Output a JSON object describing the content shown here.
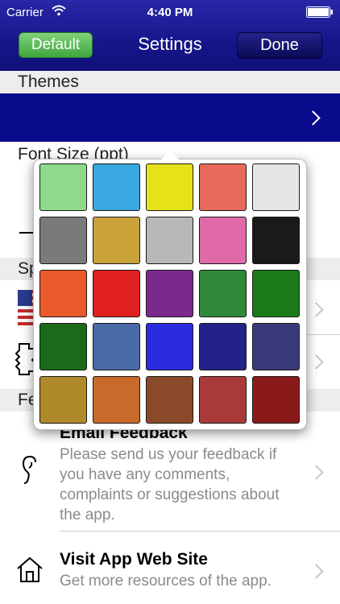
{
  "status_bar": {
    "carrier": "Carrier",
    "time": "4:40 PM"
  },
  "nav": {
    "default_label": "Default",
    "title": "Settings",
    "done_label": "Done"
  },
  "sections": {
    "themes": "Themes",
    "font_size": "Font Size (ppt)",
    "speech": "Sp",
    "feedback": "Fe"
  },
  "rows": {
    "email_title": "Email Feedback",
    "email_desc": "Please send us your feedback if you have any comments, complaints or suggestions about the app.",
    "web_title": "Visit App Web Site",
    "web_desc": "Get more resources of the app."
  },
  "colors": {
    "theme_selected": "#0a0a8c",
    "nav_bar": "#16168a",
    "default_button": "#4caf50"
  },
  "swatches": [
    [
      "#8fd98a",
      "#3aa7e0",
      "#e6e21a",
      "#e86a5a",
      "#e6e6e6"
    ],
    [
      "#7a7a7a",
      "#c9a23a",
      "#b8b8b8",
      "#e06aa8",
      "#1a1a1a"
    ],
    [
      "#e85a2a",
      "#e02020",
      "#7a2a8c",
      "#2e8a3a",
      "#1a7a1a"
    ],
    [
      "#1a6a1a",
      "#4a6aa8",
      "#2a2ae0",
      "#22228a",
      "#3a3a7a"
    ],
    [
      "#b08a2a",
      "#c86a2a",
      "#8a4a2a",
      "#a83a3a",
      "#8a1a1a"
    ]
  ]
}
